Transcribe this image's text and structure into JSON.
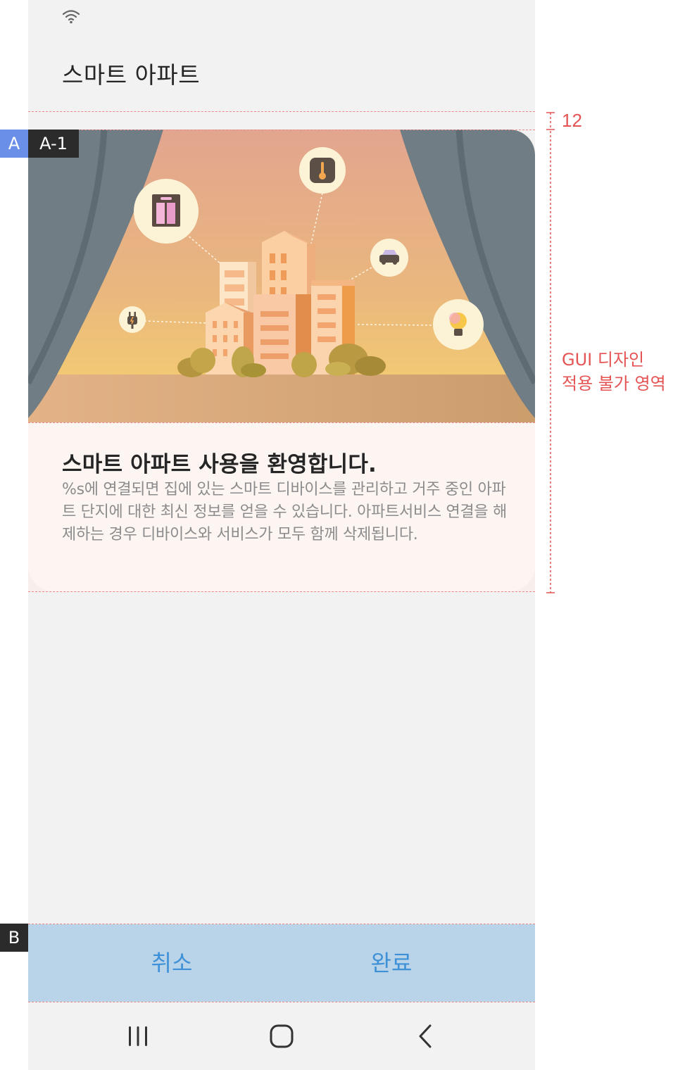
{
  "app": {
    "title": "스마트 아파트"
  },
  "card": {
    "title": "스마트 아파트 사용을 환영합니다.",
    "description": " %s에 연결되면 집에 있는 스마트 디바이스를 관리하고 거주 중인 아파트 단지에 대한 최신 정보를 얻을 수 있습니다. 아파트서비스 연결을 해제하는 경우 디바이스와 서비스가 모두 함께 삭제됩니다."
  },
  "buttons": {
    "cancel": "취소",
    "done": "완료"
  },
  "annotations": {
    "tag_a": "A",
    "tag_a1": "A-1",
    "tag_b": "B",
    "spacing": "12",
    "gui_note_line1": "GUI 디자인",
    "gui_note_line2": "적용 불가 영역"
  },
  "icons": {
    "status": "wifi-icon",
    "illustration": [
      "elevator-icon",
      "thermometer-icon",
      "car-icon",
      "plug-icon",
      "lightbulb-icon"
    ],
    "nav": [
      "recent-apps-icon",
      "home-icon",
      "back-icon"
    ]
  },
  "colors": {
    "background": "#f2f2f2",
    "card": "#fcf5f2",
    "button_bar": "#b9d3e9",
    "button_text": "#3e91d6",
    "annotation_red": "#e55454",
    "tag_blue": "#6a8fe8",
    "tag_dark": "#2b2b2b"
  }
}
